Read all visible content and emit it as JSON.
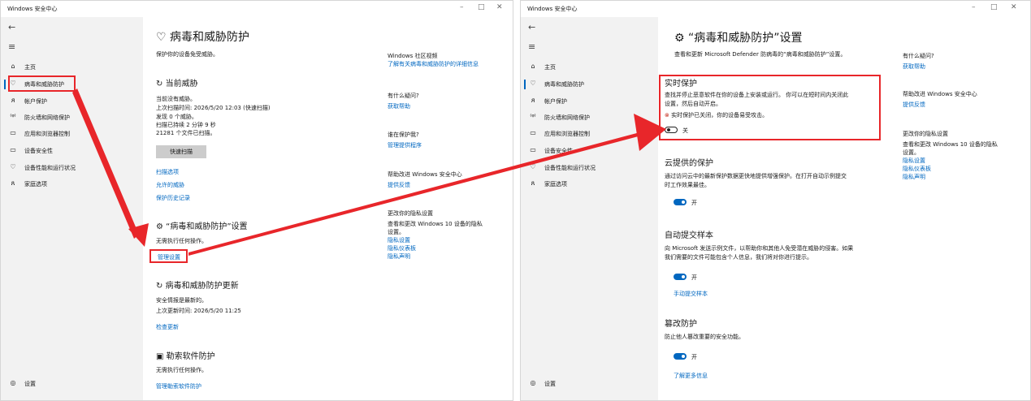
{
  "colors": {
    "accent": "#0067c0",
    "highlight": "#e8262a",
    "sidebar": "#f2f2f2"
  },
  "app_title": "Windows 安全中心",
  "nav": {
    "back_glyph": "←",
    "menu_glyph": "≡",
    "items": [
      {
        "icon": "⌂",
        "label": "主页"
      },
      {
        "icon": "♡",
        "label": "病毒和威胁防护"
      },
      {
        "icon": "ᴙ",
        "label": "帐户保护"
      },
      {
        "icon": "⁽ᵠ⁾",
        "label": "防火墙和网络保护"
      },
      {
        "icon": "▭",
        "label": "应用和浏览器控制"
      },
      {
        "icon": "▭",
        "label": "设备安全性"
      },
      {
        "icon": "♡",
        "label": "设备性能和运行状况"
      },
      {
        "icon": "ጸ",
        "label": "家庭选项"
      }
    ],
    "settings_icon": "◎",
    "settings_label": "设置"
  },
  "left": {
    "title_icon": "♡",
    "title": "病毒和威胁防护",
    "subtitle": "保护你的设备免受威胁。",
    "current_threats": {
      "icon": "↻",
      "heading": "当前威胁",
      "lines": [
        "当前没有威胁。",
        "上次扫描时间: 2026/5/20 12:03 (快速扫描)",
        "发现 0 个威胁。",
        "扫描已持续 2 分钟 9 秒",
        "21281 个文件已扫描。"
      ],
      "quick_scan": "快速扫描",
      "links": [
        "扫描选项",
        "允许的威胁",
        "保护历史记录"
      ]
    },
    "settings": {
      "icon": "⚙",
      "heading": "“病毒和威胁防护”设置",
      "text": "无需执行任何操作。",
      "manage_link": "管理设置"
    },
    "updates": {
      "icon": "↻",
      "heading": "病毒和威胁防护更新",
      "lines": [
        "安全情报是最新的。",
        "上次更新时间: 2026/5/20 11:25"
      ],
      "link": "检查更新"
    },
    "ransomware": {
      "icon": "▣",
      "heading": "勒索软件防护",
      "text": "无需执行任何操作。",
      "link": "管理勒索软件防护"
    },
    "right_col": {
      "community": {
        "heading": "Windows 社区视频",
        "link": "了解有关病毒和威胁防护的详细信息"
      },
      "question": {
        "heading": "有什么疑问?",
        "link": "获取帮助"
      },
      "who": {
        "heading": "谁在保护我?",
        "link": "管理提供程序"
      },
      "improve": {
        "heading": "帮助改进 Windows 安全中心",
        "link": "提供反馈"
      },
      "privacy": {
        "heading": "更改你的隐私设置",
        "text_1": "查看和更改 Windows 10 设备的隐私",
        "text_2": "设置。",
        "links": [
          "隐私设置",
          "隐私仪表板",
          "隐私声明"
        ]
      }
    }
  },
  "right": {
    "title_icon": "⚙",
    "title": "“病毒和威胁防护”设置",
    "subtitle": "查看和更新 Microsoft Defender 防病毒的“病毒和威胁防护”设置。",
    "realtime": {
      "heading": "实时保护",
      "desc_1": "查找并停止恶意软件在你的设备上安装或运行。 你可以在短时间内关闭此",
      "desc_2": "设置，然后自动开启。",
      "warning": "实时保护已关闭，你的设备易受攻击。",
      "toggle_label": "关"
    },
    "cloud": {
      "heading": "云提供的保护",
      "desc_1": "通过访问云中的最新保护数据更快地提供增强保护。在打开自动示例提交",
      "desc_2": "时工作效果最佳。",
      "toggle_label": "开"
    },
    "sample": {
      "heading": "自动提交样本",
      "desc_1": "向 Microsoft 发送示例文件，以帮助你和其他人免受潜在威胁的侵害。如果",
      "desc_2": "我们需要的文件可能包含个人信息，我们将对你进行提示。",
      "toggle_label": "开",
      "link": "手动提交样本"
    },
    "tamper": {
      "heading": "篡改防护",
      "desc": "防止他人篡改重要的安全功能。",
      "toggle_label": "开",
      "link": "了解更多信息"
    },
    "right_col": {
      "question": {
        "heading": "有什么疑问?",
        "link": "获取帮助"
      },
      "improve": {
        "heading": "帮助改进 Windows 安全中心",
        "link": "提供反馈"
      },
      "privacy": {
        "heading": "更改你的隐私设置",
        "text_1": "查看和更改 Windows 10 设备的隐私",
        "text_2": "设置。",
        "links": [
          "隐私设置",
          "隐私仪表板",
          "隐私声明"
        ]
      }
    }
  }
}
